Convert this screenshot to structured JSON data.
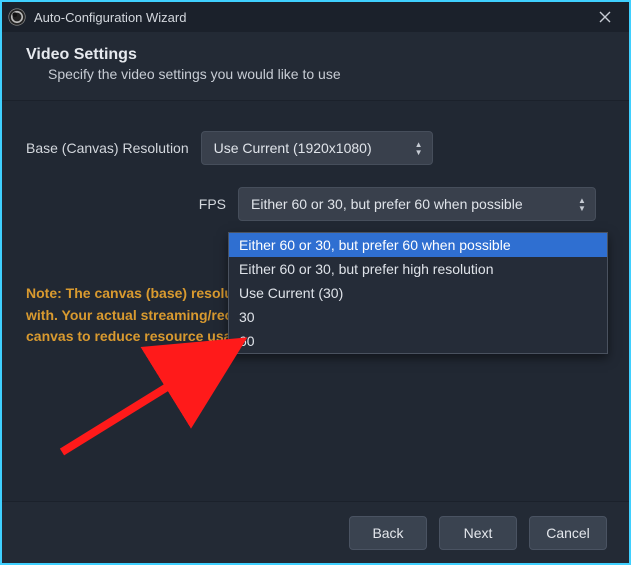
{
  "window": {
    "title": "Auto-Configuration Wizard"
  },
  "header": {
    "title": "Video Settings",
    "subtitle": "Specify the video settings you would like to use"
  },
  "fields": {
    "resolution": {
      "label": "Base (Canvas) Resolution",
      "value": "Use Current (1920x1080)"
    },
    "fps": {
      "label": "FPS",
      "value": "Either 60 or 30, but prefer 60 when possible",
      "options": [
        "Either 60 or 30, but prefer 60 when possible",
        "Either 60 or 30, but prefer high resolution",
        "Use Current (30)",
        "30",
        "60"
      ]
    }
  },
  "note": "Note: The canvas (base) resolution is not necessarily the resolution you will stream with. Your actual streaming/recording resolution may be scaled down from the canvas to reduce resource usage and bandwidth.",
  "buttons": {
    "back": "Back",
    "next": "Next",
    "cancel": "Cancel"
  },
  "colors": {
    "accent": "#3fd0ff",
    "selection": "#2f6fd1",
    "warning": "#d99a2f"
  }
}
